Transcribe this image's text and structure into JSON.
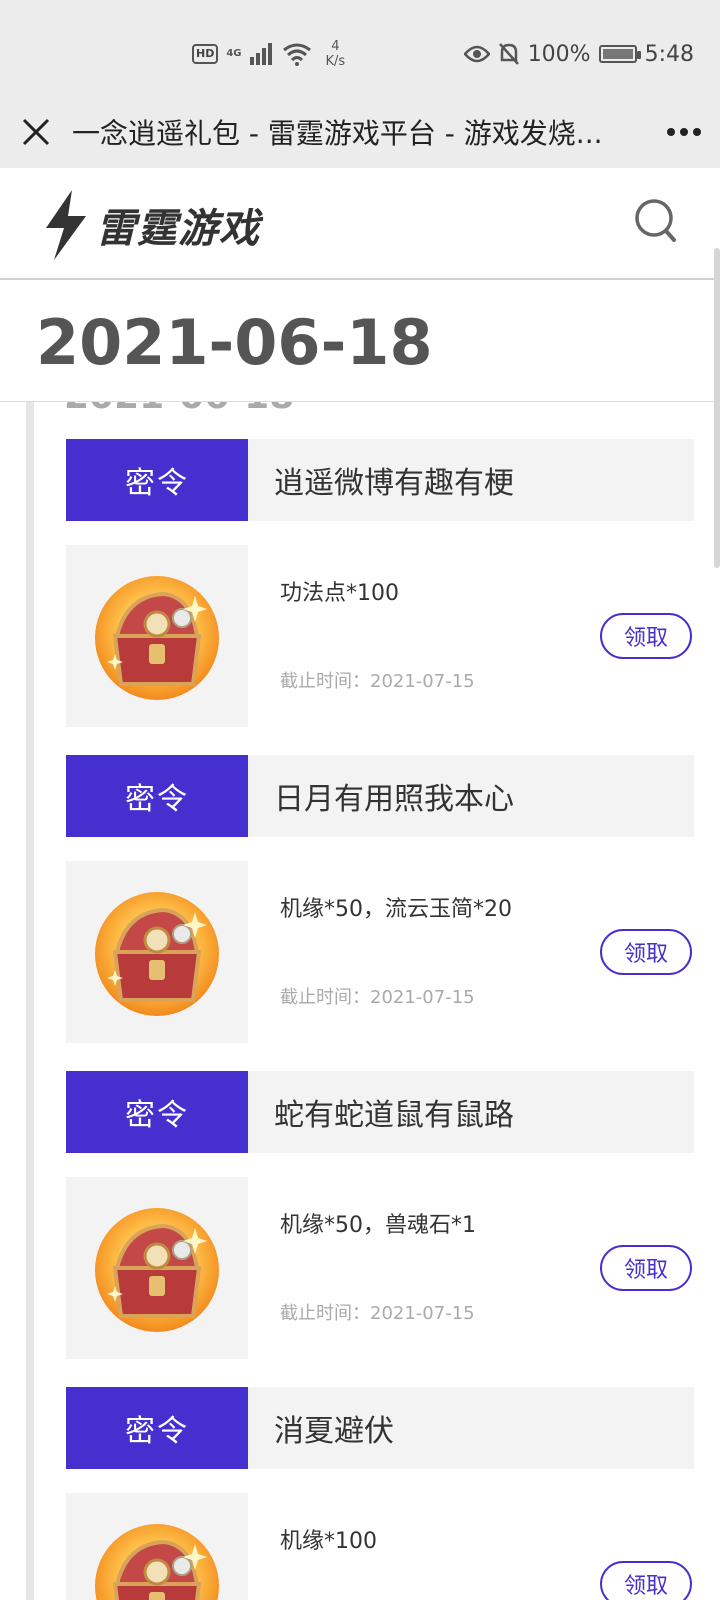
{
  "status_bar": {
    "hd": "HD",
    "network": "4G",
    "speed_value": "4",
    "speed_unit": "K/s",
    "battery": "100%",
    "battery_level": 1.0,
    "time": "5:48"
  },
  "title_bar": {
    "title": "一念逍遥礼包 - 雷霆游戏平台 - 游戏发烧..."
  },
  "site": {
    "logo_text": "雷霆游戏",
    "brand_color": "#4530cf"
  },
  "date_header": "2021-06-18",
  "gifts": [
    {
      "badge": "密令",
      "name": "逍遥微博有趣有梗",
      "reward": "功法点*100",
      "deadline": "截止时间：2021-07-15",
      "claim": "领取"
    },
    {
      "badge": "密令",
      "name": "日月有用照我本心",
      "reward": "机缘*50，流云玉简*20",
      "deadline": "截止时间：2021-07-15",
      "claim": "领取"
    },
    {
      "badge": "密令",
      "name": "蛇有蛇道鼠有鼠路",
      "reward": "机缘*50，兽魂石*1",
      "deadline": "截止时间：2021-07-15",
      "claim": "领取"
    },
    {
      "badge": "密令",
      "name": "消夏避伏",
      "reward": "机缘*100",
      "deadline": "",
      "claim": "领取"
    }
  ]
}
